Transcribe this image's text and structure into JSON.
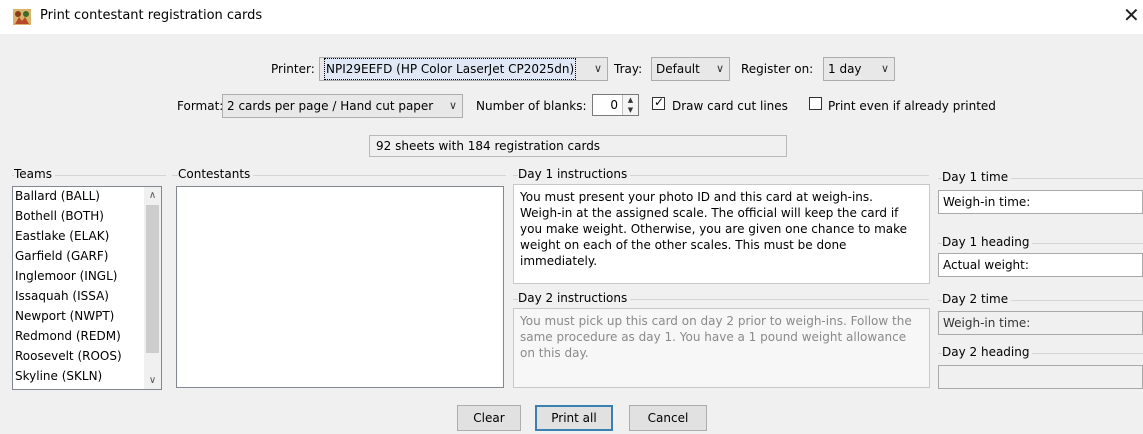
{
  "window": {
    "title": "Print contestant registration cards"
  },
  "row1": {
    "printer_label": "Printer:",
    "printer_value": "NPI29EEFD (HP Color LaserJet CP2025dn)",
    "tray_label": "Tray:",
    "tray_value": "Default",
    "register_label": "Register on:",
    "register_value": "1 day"
  },
  "row2": {
    "format_label": "Format:",
    "format_value": "2 cards per page / Hand cut paper",
    "blanks_label": "Number of blanks:",
    "blanks_value": "0",
    "cutlines_label": "Draw card cut lines",
    "cutlines_checked": true,
    "reprint_label": "Print even if already printed",
    "reprint_checked": false
  },
  "summary": "92 sheets with 184 registration cards",
  "teams": {
    "label": "Teams",
    "items": [
      "Ballard (BALL)",
      "Bothell (BOTH)",
      "Eastlake (ELAK)",
      "Garfield (GARF)",
      "Inglemoor (INGL)",
      "Issaquah (ISSA)",
      "Newport (NWPT)",
      "Redmond (REDM)",
      "Roosevelt (ROOS)",
      "Skyline (SKLN)"
    ]
  },
  "contestants": {
    "label": "Contestants",
    "items": []
  },
  "day1_instructions": {
    "label": "Day 1 instructions",
    "lines": [
      "You must present your photo ID and this card at weigh-ins.",
      "Weigh-in at the assigned scale.  The official will keep the card if",
      "you make weight. Otherwise, you are given one chance to make",
      "weight on each of the other scales. This must be done",
      "immediately."
    ]
  },
  "day2_instructions": {
    "label": "Day 2 instructions",
    "lines": [
      "You must pick up this card on day 2 prior to weigh-ins. Follow the",
      "same procedure as day 1. You have a 1 pound weight allowance",
      "on this day."
    ]
  },
  "day1_time": {
    "label": "Day 1 time",
    "value": "Weigh-in time:"
  },
  "day1_heading": {
    "label": "Day 1 heading",
    "value": "Actual weight:"
  },
  "day2_time": {
    "label": "Day 2 time",
    "value": "Weigh-in time:"
  },
  "day2_heading": {
    "label": "Day 2 heading",
    "value": ""
  },
  "buttons": {
    "clear": "Clear",
    "print_all": "Print all",
    "cancel": "Cancel"
  },
  "colors": {
    "default_button_border": "#3c7fb1",
    "disabled_text": "#8a8a8a"
  },
  "icons": {
    "app": "wrestlers-icon",
    "close": "close-icon",
    "dropdown": "chevron-down-icon",
    "check": "checkmark-icon"
  }
}
